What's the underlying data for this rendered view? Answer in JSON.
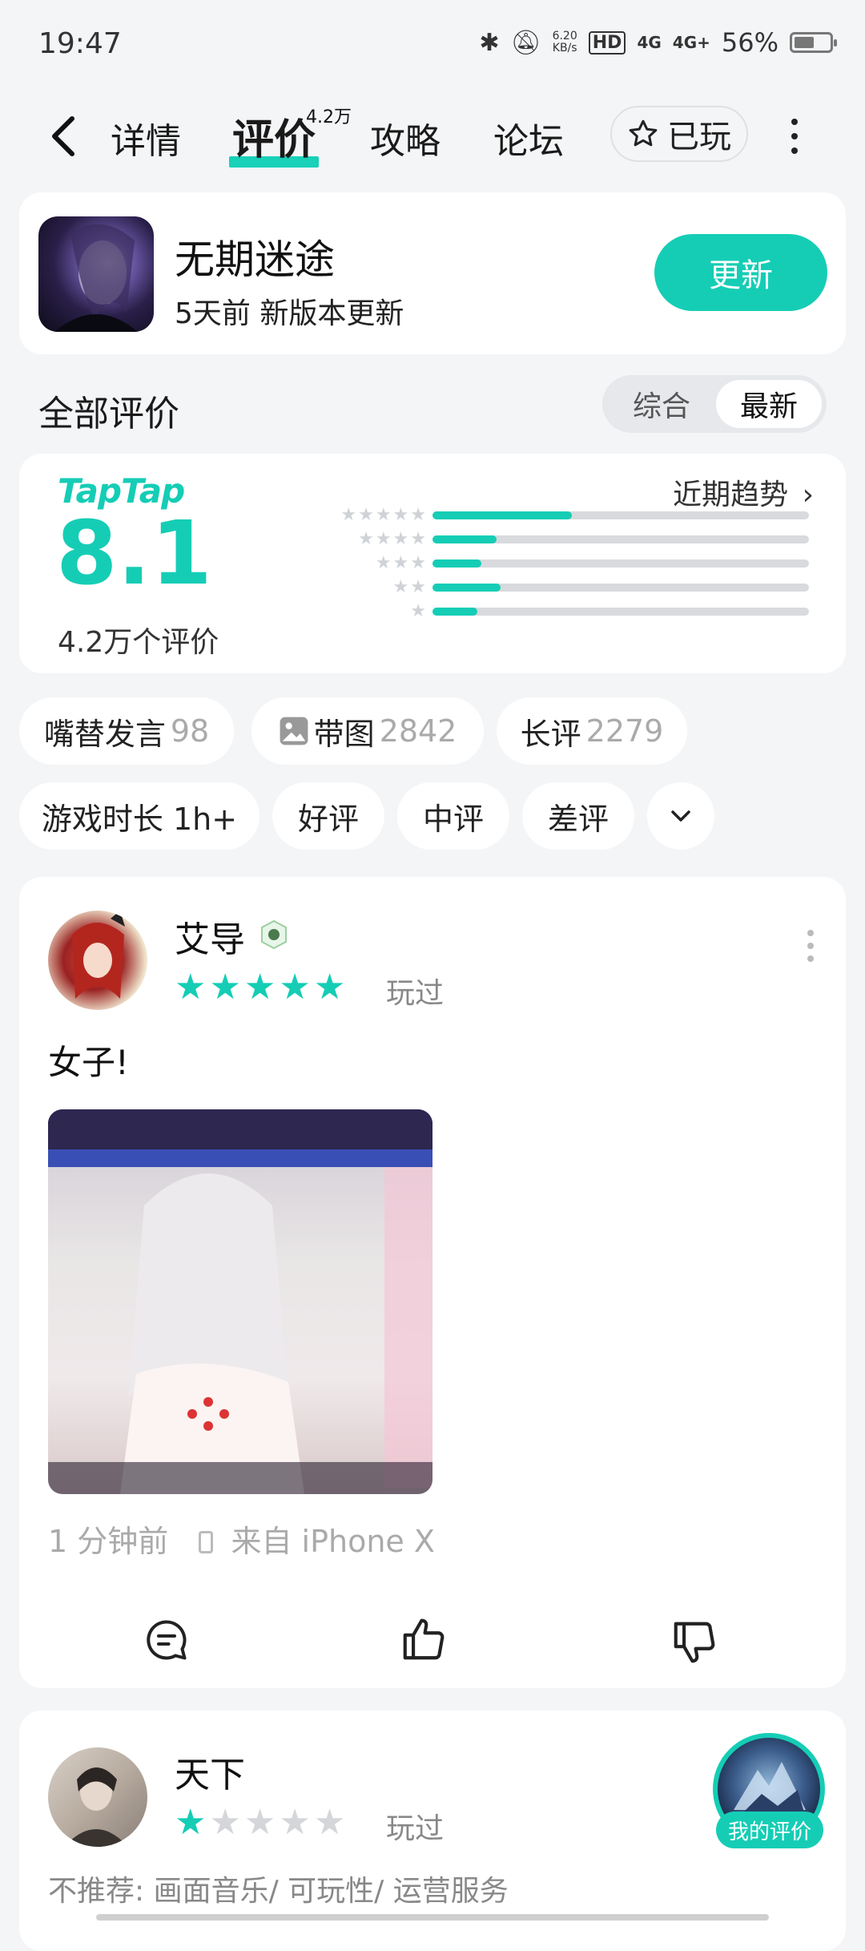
{
  "status_bar": {
    "time": "19:47",
    "net_speed": "6.20",
    "net_unit": "KB/s",
    "hd": "HD",
    "sig1": "4G",
    "sig2": "4G+",
    "battery": "56%",
    "battery_level": 0.56
  },
  "nav": {
    "tabs": [
      {
        "label": "详情"
      },
      {
        "label": "评价",
        "badge": "4.2万"
      },
      {
        "label": "攻略"
      },
      {
        "label": "论坛"
      }
    ],
    "played_label": "已玩"
  },
  "game": {
    "title": "无期迷途",
    "subtitle": "5天前 新版本更新",
    "update_label": "更新"
  },
  "reviews_header": {
    "title": "全部评价",
    "sort_options": [
      "综合",
      "最新"
    ],
    "selected_sort": "最新"
  },
  "rating": {
    "brand": "TapTap",
    "score": "8.1",
    "count_label": "4.2万个评价",
    "trend_label": "近期趋势",
    "distribution": [
      {
        "stars": 5,
        "fraction": 0.37
      },
      {
        "stars": 4,
        "fraction": 0.17
      },
      {
        "stars": 3,
        "fraction": 0.13
      },
      {
        "stars": 2,
        "fraction": 0.18
      },
      {
        "stars": 1,
        "fraction": 0.12
      }
    ]
  },
  "filters": {
    "row1": [
      {
        "label": "嘴替发言",
        "count": "98"
      },
      {
        "label": "带图",
        "count": "2842"
      },
      {
        "label": "长评",
        "count": "2279"
      }
    ],
    "row2": [
      {
        "label": "游戏时长 1h+"
      },
      {
        "label": "好评"
      },
      {
        "label": "中评"
      },
      {
        "label": "差评"
      }
    ]
  },
  "review1": {
    "user": "艾导",
    "rating": 5,
    "played": "玩过",
    "text": "女子!",
    "time": "1 分钟前",
    "device": "来自 iPhone X"
  },
  "review2": {
    "user": "天下",
    "rating": 1,
    "played": "玩过",
    "text": "不推荐: 画面音乐/ 可玩性/ 运营服务"
  },
  "my_review_label": "我的评价",
  "colors": {
    "accent": "#15cdb5"
  }
}
